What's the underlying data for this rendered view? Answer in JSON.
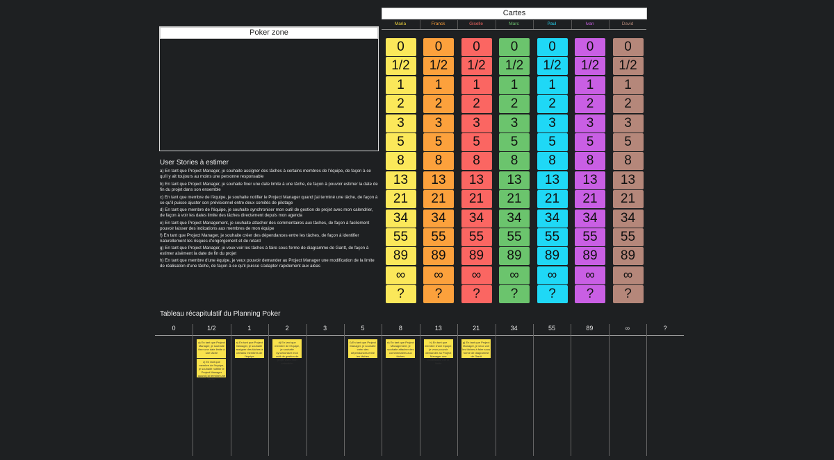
{
  "cartes_title": "Cartes",
  "poker_zone_title": "Poker zone",
  "players": [
    {
      "name": "Maria",
      "color": "#fbe85a",
      "text": "#e9cf3c"
    },
    {
      "name": "Franck",
      "color": "#fca13c",
      "text": "#f29a39"
    },
    {
      "name": "Giselle",
      "color": "#fb6662",
      "text": "#f06560"
    },
    {
      "name": "Marc",
      "color": "#6bc46d",
      "text": "#6bbf6d"
    },
    {
      "name": "Paul",
      "color": "#1fd8f6",
      "text": "#25d1ee"
    },
    {
      "name": "Ivan",
      "color": "#c95fe4",
      "text": "#c55fe0"
    },
    {
      "name": "David",
      "color": "#b5877a",
      "text": "#b08577"
    }
  ],
  "card_values": [
    "0",
    "1/2",
    "1",
    "2",
    "3",
    "5",
    "8",
    "13",
    "21",
    "34",
    "55",
    "89",
    "∞",
    "?"
  ],
  "stories_title": "User Stories à estimer",
  "stories": [
    "a) En tant que Project Manager, je souhaite assigner des tâches à certains membres de l'équipe, de façon à ce qu'il y ait toujours au moins une personne responsable",
    "b) En tant que Project Manager, je souhaite fixer une date limite à une tâche, de façon à pouvoir estimer la date de fin du projet dans son ensemble",
    "c) En tant que membre de l'équipe, je souhaite notifier le Project Manager quand j'ai terminé une tâche, de façon à ce qu'il puisse ajuster son prévisionnel entre deux comités de pilotage",
    "d) En tant que membre de l'équipe, je souhaite synchroniser mon outil de gestion de projet avec mon calendrier, de façon à voir les dates limite des tâches directement depuis mon agenda",
    "e) En tant que Project Management, je souhaite attacher des commentaires aux tâches, de façon à facilement pouvoir laisser des indications aux membres de mon équipe",
    "f) En tant que Project Manager, je souhaite créer des dépendances entre les tâches, de façon à identifier naturellement les risques d'engorgement et de retard",
    "g) En tant que Project Manager, je veux voir les tâches à faire sous forme de diagramme de Gantt, de façon à estimer aisément la date de fin du projet",
    "h) En tant que membre d'une équipe, je veux pouvoir demander au Project Manager une modification de la limite de réalisation d'une tâche, de façon à ce qu'il puisse s'adapter rapidement aux aléas"
  ],
  "table_title": "Tableau récapitulatif du Planning Poker",
  "table_columns": [
    "0",
    "1/2",
    "1",
    "2",
    "3",
    "5",
    "8",
    "13",
    "21",
    "34",
    "55",
    "89",
    "∞",
    "?"
  ],
  "stickies": [
    {
      "col": 1,
      "row": 0,
      "text": "a) En tant que Project Manager, je souhaite fixer une date limite à une tâche"
    },
    {
      "col": 1,
      "row": 1,
      "text": "c) En tant que membre de l'équipe, je souhaite notifier le Project Manager quand j'ai terminé une tâche"
    },
    {
      "col": 2,
      "row": 0,
      "text": "a) En tant que Project Manager, je souhaite assigner des tâches à certains membres de l'équipe"
    },
    {
      "col": 3,
      "row": 0,
      "text": "d) En tant que membre de l'équipe, je souhaite synchroniser mon outil de gestion de projet avec mon calendrier"
    },
    {
      "col": 5,
      "row": 0,
      "text": "f) En tant que Project Manager, je souhaite créer des dépendances entre les tâches"
    },
    {
      "col": 6,
      "row": 0,
      "text": "e) En tant que Project Management, je souhaite attacher des commentaires aux tâches"
    },
    {
      "col": 7,
      "row": 0,
      "text": "h) En tant que membre d'une équipe, je veux pouvoir demander au Project Manager une modification de la limite"
    },
    {
      "col": 8,
      "row": 0,
      "text": "g) En tant que Project Manager, je veux voir les tâches à faire sous forme de diagramme de Gantt"
    }
  ]
}
